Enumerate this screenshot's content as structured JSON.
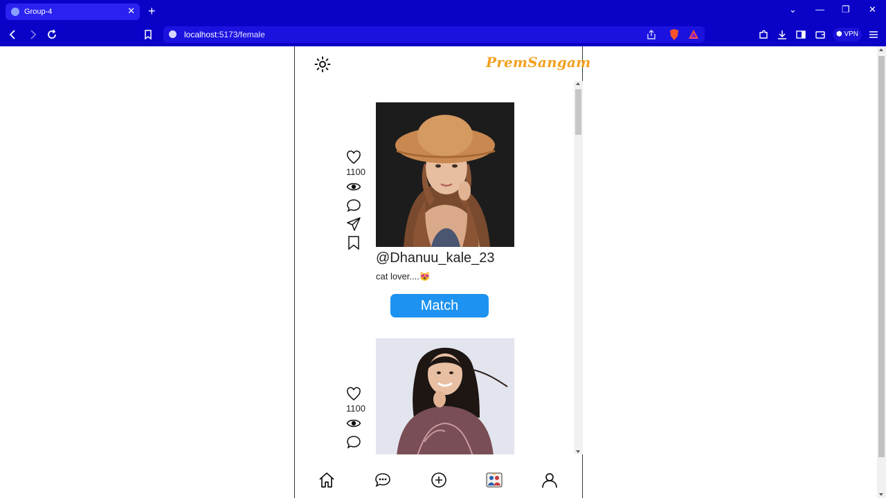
{
  "browser": {
    "tab_title": "Group-4",
    "url_host": "localhost",
    "url_rest": ":5173/female",
    "vpn_label": "VPN",
    "colors": {
      "chrome": "#0b02c8"
    }
  },
  "app": {
    "brand": "PremSangam",
    "colors": {
      "brand": "#f2a11f",
      "match_button": "#1d92f0"
    },
    "posts": [
      {
        "likes": "1100",
        "username": "@Dhanuu_kale_23",
        "bio": "cat lover....😻",
        "match_label": "Match"
      },
      {
        "likes": "1100"
      }
    ],
    "bottom_nav": [
      "home-icon",
      "chat-icon",
      "add-icon",
      "matches-icon",
      "profile-icon"
    ]
  }
}
